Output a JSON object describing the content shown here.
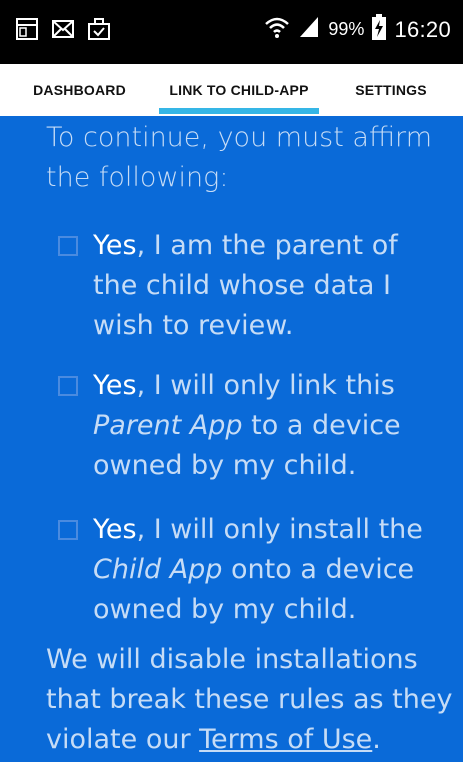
{
  "status_bar": {
    "battery_text": "99%",
    "time": "16:20",
    "icons_left": [
      "screen-capture-icon",
      "mail-icon",
      "briefcase-icon"
    ],
    "icons_right": [
      "wifi-icon",
      "signal-icon",
      "battery-charging-icon"
    ]
  },
  "tabs": [
    {
      "label": "DASHBOARD",
      "active": false
    },
    {
      "label": "LINK TO CHILD-APP",
      "active": true
    },
    {
      "label": "SETTINGS",
      "active": false
    }
  ],
  "content": {
    "intro": "To continue, you must affirm the following:",
    "affirmations": [
      {
        "yes": "Yes",
        "text_before": ", I am the parent of the child whose data I wish to review.",
        "italic": "",
        "text_after": ""
      },
      {
        "yes": "Yes",
        "text_before": ", I will only link this ",
        "italic": "Parent App",
        "text_after": " to a device owned by my child."
      },
      {
        "yes": "Yes",
        "text_before": ", I will only install the ",
        "italic": "Child App",
        "text_after": " onto a device owned by my child."
      }
    ],
    "closing_before": "We will disable installations that break these rules as they violate our ",
    "closing_link": "Terms of Use",
    "closing_after": "."
  },
  "colors": {
    "background": "#0a6ad8",
    "tab_indicator": "#35b6e6",
    "text_muted": "#c6dcf6",
    "text_bright": "#ffffff"
  }
}
